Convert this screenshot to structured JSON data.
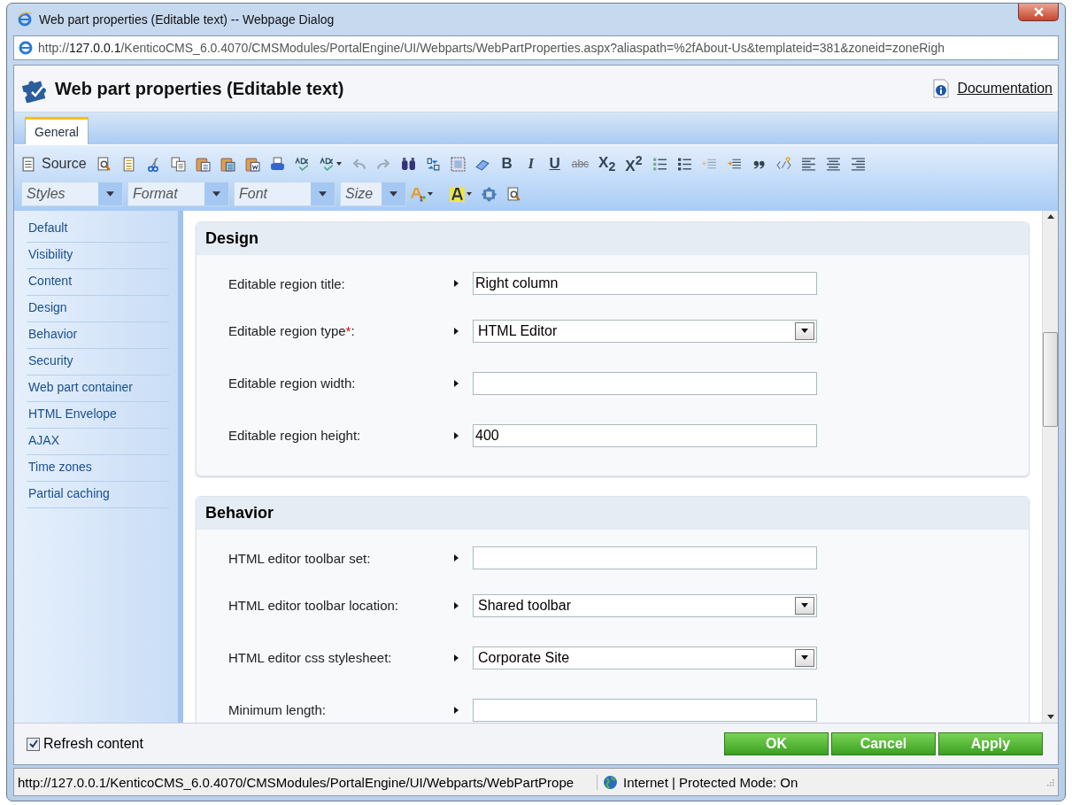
{
  "window": {
    "title": "Web part properties (Editable text) -- Webpage Dialog"
  },
  "address_bar": {
    "prefix": "http://",
    "host": "127.0.0.1",
    "path": "/KenticoCMS_6.0.4070/CMSModules/PortalEngine/UI/Webparts/WebPartProperties.aspx?aliaspath=%2fAbout-Us&templateid=381&zoneid=zoneRigh"
  },
  "header": {
    "title": "Web part properties (Editable text)",
    "documentation_link": "Documentation"
  },
  "tabs": [
    {
      "label": "General",
      "selected": true
    }
  ],
  "toolbar": {
    "source_label": "Source",
    "text_buttons": [
      "B",
      "I",
      "U",
      "abc",
      "X$_{2}$",
      "X$^{2}$"
    ],
    "combos": [
      {
        "placeholder": "Styles"
      },
      {
        "placeholder": "Format"
      },
      {
        "placeholder": "Font"
      },
      {
        "placeholder": "Size"
      }
    ]
  },
  "sidebar": {
    "items": [
      {
        "label": "Default",
        "selected": false
      },
      {
        "label": "Visibility",
        "selected": false
      },
      {
        "label": "Content",
        "selected": false
      },
      {
        "label": "Design",
        "selected": false
      },
      {
        "label": "Behavior",
        "selected": false
      },
      {
        "label": "Security",
        "selected": false
      },
      {
        "label": "Web part container",
        "selected": false
      },
      {
        "label": "HTML Envelope",
        "selected": false
      },
      {
        "label": "AJAX",
        "selected": false
      },
      {
        "label": "Time zones",
        "selected": false
      },
      {
        "label": "Partial caching",
        "selected": false
      }
    ]
  },
  "sections": [
    {
      "title": "Design",
      "fields": [
        {
          "label": "Editable region title:",
          "kind": "text",
          "value": "Right column"
        },
        {
          "label": "Editable region type",
          "required_mark": "*",
          "label_end": ":",
          "kind": "select",
          "value": "HTML Editor"
        },
        {
          "label": "Editable region width:",
          "kind": "text"
        },
        {
          "label": "Editable region height:",
          "kind": "text",
          "value": "400"
        }
      ]
    },
    {
      "title": "Behavior",
      "fields": [
        {
          "label": "HTML editor toolbar set:",
          "kind": "text"
        },
        {
          "label": "HTML editor toolbar location:",
          "kind": "select",
          "value": "Shared toolbar"
        },
        {
          "label": "HTML editor css stylesheet:",
          "kind": "select",
          "value": "Corporate Site"
        },
        {
          "label": "Minimum length:",
          "kind": "text"
        }
      ]
    }
  ],
  "footer": {
    "refresh": {
      "label": "Refresh content",
      "checked": true
    },
    "buttons": [
      "OK",
      "Cancel",
      "Apply"
    ]
  },
  "status_bar": {
    "url": "http://127.0.0.1/KenticoCMS_6.0.4070/CMSModules/PortalEngine/UI/Webparts/WebPartPrope",
    "zone": "Internet | Protected Mode: On"
  }
}
